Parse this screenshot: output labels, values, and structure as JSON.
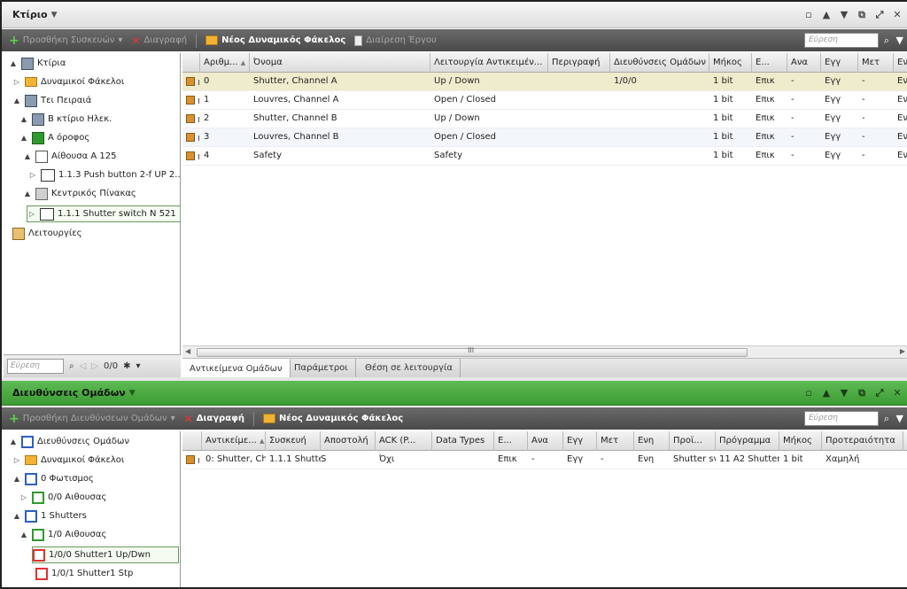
{
  "top_panel": {
    "title": "Κτίριο",
    "toolbar": {
      "add_devices": "Προσθήκη Συσκευών",
      "delete": "Διαγραφή",
      "new_dynamic_folder": "Νέος Δυναμικός Φάκελος",
      "split_project": "Διαίρεση Έργου",
      "search_placeholder": "Εύρεση"
    },
    "tree": [
      {
        "label": "Κτίρια",
        "icon": "building-icon",
        "expander": "▲"
      },
      {
        "label": "Δυναμικοί Φάκελοι",
        "icon": "folder-icon",
        "expander": "▷"
      },
      {
        "label": "Τει Πειραιά",
        "icon": "building-icon",
        "expander": "▲"
      },
      {
        "label": "Β κτίριο Ηλεκ.",
        "icon": "building-icon",
        "expander": "▲"
      },
      {
        "label": "Α όροφος",
        "icon": "floor-icon",
        "expander": "▲"
      },
      {
        "label": "Αίθουσα Α 125",
        "icon": "room-icon",
        "expander": "▲"
      },
      {
        "label": "1.1.3  Push button 2-f UP 2...",
        "icon": "device-icon",
        "expander": "▷"
      },
      {
        "label": "Κεντρικός Πίνακας",
        "icon": "panel-icon",
        "expander": "▲"
      },
      {
        "label": "1.1.1  Shutter switch N 521",
        "icon": "device-icon",
        "expander": "▷"
      },
      {
        "label": "Λειτουργίες",
        "icon": "functions-icon",
        "expander": ""
      }
    ],
    "footer": {
      "search_placeholder": "Εύρεση",
      "page": "0/0"
    },
    "grid": {
      "columns": [
        "Αριθμ...",
        "Όνομα",
        "Λειτουργία Αντικειμέν...",
        "Περιγραφή",
        "Διευθύνσεις Ομάδων",
        "Μήκος",
        "Ε...",
        "Ανα",
        "Εγγ",
        "Μετ",
        "Εν"
      ],
      "rows": [
        [
          "0",
          "Shutter, Channel A",
          "Up / Down",
          "",
          "1/0/0",
          "1 bit",
          "Επικ",
          "-",
          "Εγγ",
          "-",
          "Ενη"
        ],
        [
          "1",
          "Louvres, Channel A",
          "Open / Closed",
          "",
          "",
          "1 bit",
          "Επικ",
          "-",
          "Εγγ",
          "-",
          "Ενη"
        ],
        [
          "2",
          "Shutter, Channel B",
          "Up / Down",
          "",
          "",
          "1 bit",
          "Επικ",
          "-",
          "Εγγ",
          "-",
          "Ενη"
        ],
        [
          "3",
          "Louvres, Channel B",
          "Open / Closed",
          "",
          "",
          "1 bit",
          "Επικ",
          "-",
          "Εγγ",
          "-",
          "Ενη"
        ],
        [
          "4",
          "Safety",
          "Safety",
          "",
          "",
          "1 bit",
          "Επικ",
          "-",
          "Εγγ",
          "-",
          "Ενη"
        ]
      ]
    },
    "tabs": [
      "Αντικείμενα Ομάδων",
      "Παράμετροι",
      "Θέση σε λειτουργία"
    ]
  },
  "bottom_panel": {
    "title": "Διευθύνσεις Ομάδων",
    "toolbar": {
      "add_group_addresses": "Προσθήκη Διευθύνσεων Ομάδων",
      "delete": "Διαγραφή",
      "new_dynamic_folder": "Νέος Δυναμικός Φάκελος",
      "search_placeholder": "Εύρεση"
    },
    "tree": [
      {
        "label": "Διευθύνσεις Ομάδων",
        "icon": "group-addresses-icon",
        "expander": "▲"
      },
      {
        "label": "Δυναμικοί Φάκελοι",
        "icon": "folder-icon",
        "expander": "▷"
      },
      {
        "label": "0 Φωτισμος",
        "icon": "main-group-icon",
        "expander": "▲"
      },
      {
        "label": "0/0 Αιθουσας",
        "icon": "middle-group-icon",
        "expander": "▷"
      },
      {
        "label": "1 Shutters",
        "icon": "main-group-icon",
        "expander": "▲"
      },
      {
        "label": "1/0 Αιθουσας",
        "icon": "middle-group-icon",
        "expander": "▲"
      },
      {
        "label": "1/0/0 Shutter1 Up/Dwn",
        "icon": "group-address-icon",
        "expander": ""
      },
      {
        "label": "1/0/1 Shutter1 Stp",
        "icon": "group-address-icon",
        "expander": ""
      }
    ],
    "grid": {
      "columns": [
        "Αντικείμε...",
        "Συσκευή",
        "Αποστολή",
        "ACK (P...",
        "Data Types",
        "Ε...",
        "Ανα",
        "Εγγ",
        "Μετ",
        "Ενη",
        "Προϊ...",
        "Πρόγραμμα",
        "Μήκος",
        "Προτεραιότητα"
      ],
      "rows": [
        [
          "0: Shutter, Ch",
          "1.1.1  Shutte",
          "S",
          "Όχι",
          "",
          "Επικ",
          "-",
          "Εγγ",
          "-",
          "Ενη",
          "Shutter sv",
          "11 A2 Shutter",
          "1 bit",
          "Χαμηλή"
        ]
      ]
    }
  },
  "colors": {
    "green_title": "#4aa840",
    "toolbar_dark": "#555555",
    "selected_row": "#efeccd"
  }
}
